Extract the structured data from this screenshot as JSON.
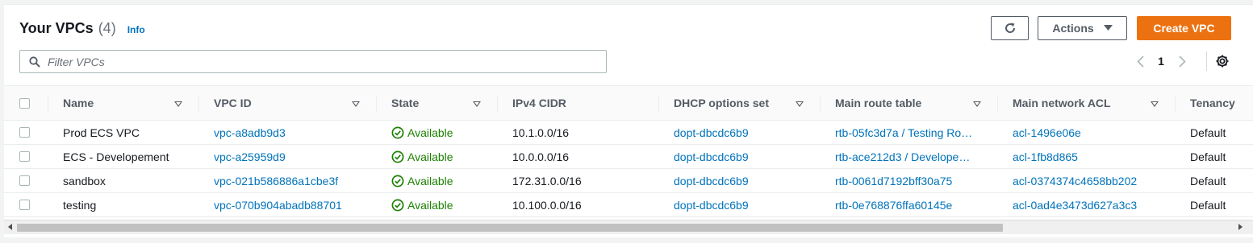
{
  "header": {
    "title": "Your VPCs",
    "count": "(4)",
    "info_label": "Info",
    "actions_label": "Actions",
    "create_label": "Create VPC"
  },
  "search": {
    "placeholder": "Filter VPCs",
    "value": ""
  },
  "pagination": {
    "current_page": "1"
  },
  "table": {
    "columns": [
      "Name",
      "VPC ID",
      "State",
      "IPv4 CIDR",
      "DHCP options set",
      "Main route table",
      "Main network ACL",
      "Tenancy"
    ],
    "rows": [
      {
        "name": "Prod ECS VPC",
        "vpc_id": "vpc-a8adb9d3",
        "state": "Available",
        "cidr": "10.1.0.0/16",
        "dhcp": "dopt-dbcdc6b9",
        "route_table": "rtb-05fc3d7a / Testing Ro…",
        "acl": "acl-1496e06e",
        "tenancy": "Default"
      },
      {
        "name": "ECS - Developement",
        "vpc_id": "vpc-a25959d9",
        "state": "Available",
        "cidr": "10.0.0.0/16",
        "dhcp": "dopt-dbcdc6b9",
        "route_table": "rtb-ace212d3 / Develope…",
        "acl": "acl-1fb8d865",
        "tenancy": "Default"
      },
      {
        "name": "sandbox",
        "vpc_id": "vpc-021b586886a1cbe3f",
        "state": "Available",
        "cidr": "172.31.0.0/16",
        "dhcp": "dopt-dbcdc6b9",
        "route_table": "rtb-0061d7192bff30a75",
        "acl": "acl-0374374c4658bb202",
        "tenancy": "Default"
      },
      {
        "name": "testing",
        "vpc_id": "vpc-070b904abadb88701",
        "state": "Available",
        "cidr": "10.100.0.0/16",
        "dhcp": "dopt-dbcdc6b9",
        "route_table": "rtb-0e768876ffa60145e",
        "acl": "acl-0ad4e3473d627a3c3",
        "tenancy": "Default"
      }
    ]
  },
  "icons": {
    "refresh": "refresh-icon",
    "actions_caret": "caret-down-icon",
    "search": "search-icon",
    "prev_page": "chevron-left-icon",
    "next_page": "chevron-right-icon",
    "settings": "gear-icon",
    "status": "check-circle-icon"
  },
  "colors": {
    "primary": "#ec7211",
    "link": "#0073bb",
    "success": "#1d8102"
  }
}
